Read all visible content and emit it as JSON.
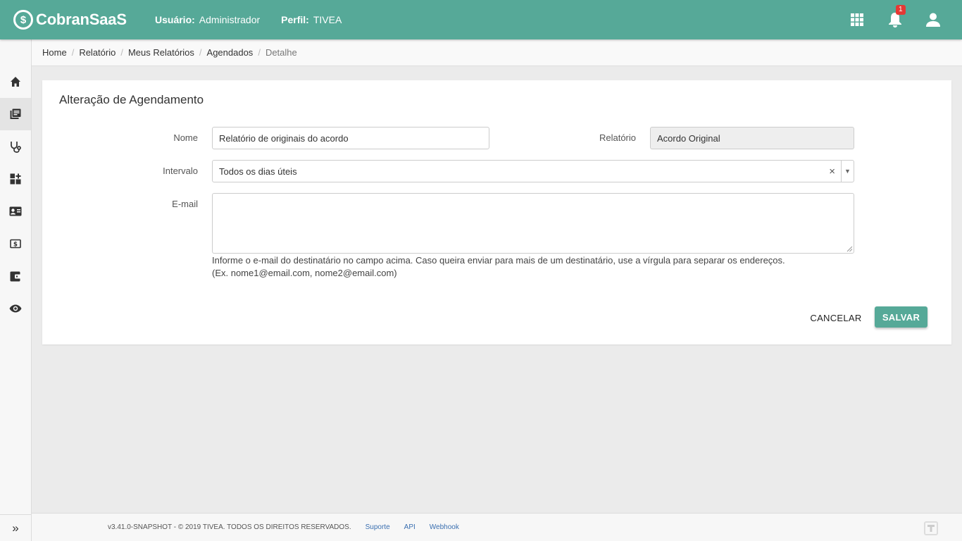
{
  "app": {
    "logo_text": "CobranSaaS",
    "logo_mark": "$"
  },
  "header": {
    "user_label": "Usuário:",
    "user_value": "Administrador",
    "profile_label": "Perfil:",
    "profile_value": "TIVEA",
    "notification_count": "1",
    "icons": [
      "apps-grid-icon",
      "bell-icon",
      "user-account-icon"
    ]
  },
  "sidebar": {
    "items": [
      {
        "icon": "home-icon"
      },
      {
        "icon": "reports-icon",
        "active": true
      },
      {
        "icon": "stethoscope-icon"
      },
      {
        "icon": "dashboard-add-icon"
      },
      {
        "icon": "contact-card-icon"
      },
      {
        "icon": "money-icon"
      },
      {
        "icon": "wallet-icon"
      },
      {
        "icon": "eye-icon"
      }
    ],
    "expand_icon": "»"
  },
  "breadcrumb": {
    "items": [
      "Home",
      "Relatório",
      "Meus Relatórios",
      "Agendados",
      "Detalhe"
    ],
    "separator": "/"
  },
  "form": {
    "title": "Alteração de Agendamento",
    "nome_label": "Nome",
    "nome_value": "Relatório de originais do acordo",
    "relatorio_label": "Relatório",
    "relatorio_value": "Acordo Original",
    "intervalo_label": "Intervalo",
    "intervalo_value": "Todos os dias úteis",
    "clear_symbol": "×",
    "arrow_symbol": "▼",
    "email_label": "E-mail",
    "email_value": "",
    "help_line1": "Informe o e-mail do destinatário no campo acima. Caso queira enviar para mais de um destinatário, use a vírgula para separar os endereços.",
    "help_line2": "(Ex. nome1@email.com, nome2@email.com)",
    "cancel_label": "CANCELAR",
    "save_label": "SALVAR"
  },
  "footer": {
    "copyright": "v3.41.0-SNAPSHOT - © 2019 TIVEA. TODOS OS DIREITOS RESERVADOS.",
    "links": [
      "Suporte",
      "API",
      "Webhook"
    ]
  },
  "colors": {
    "primary": "#56a998",
    "badge": "#e53935",
    "link": "#3a6fb0"
  }
}
